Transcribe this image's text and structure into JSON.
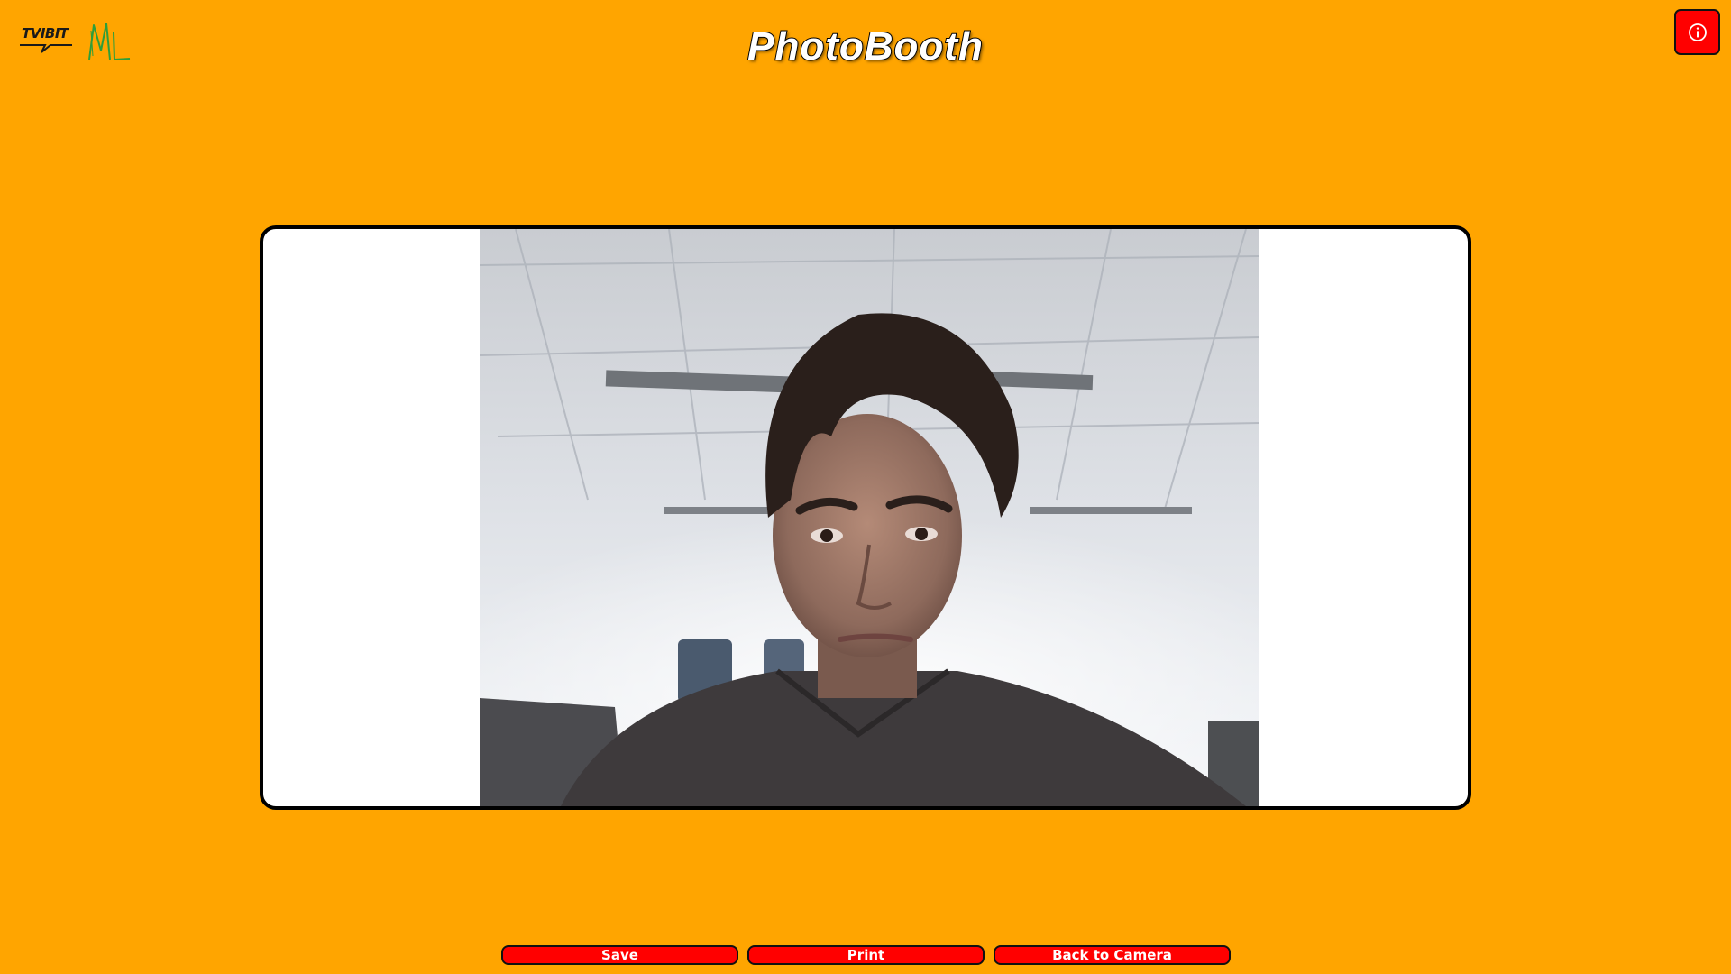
{
  "header": {
    "title": "PhotoBooth",
    "logos": [
      {
        "name": "tvibit-logo",
        "text": "TVIBIT"
      },
      {
        "name": "ml-logo",
        "text": "ML"
      }
    ],
    "info_icon": "info-circle-icon"
  },
  "photo": {
    "description_icon": "captured-selfie-image"
  },
  "actions": {
    "save_label": "Save",
    "print_label": "Print",
    "back_label": "Back to Camera"
  },
  "colors": {
    "background": "#ffa500",
    "button": "#ff0000",
    "frame": "#ffffff"
  }
}
